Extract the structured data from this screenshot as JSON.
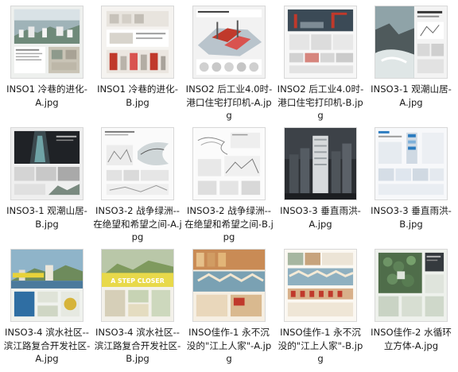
{
  "files": [
    {
      "name": "INSO1 冷巷的进化-A.jpg",
      "style": "coast"
    },
    {
      "name": "INSO1 冷巷的进化-B.jpg",
      "style": "lightboard-red"
    },
    {
      "name": "INSO2 后工业4.0时-港口住宅打印机-A.jpg",
      "style": "port-red"
    },
    {
      "name": "INSO2 后工业4.0时-港口住宅打印机-B.jpg",
      "style": "diagram-red"
    },
    {
      "name": "INSO3-1 观潮山居-A.jpg",
      "style": "cliff"
    },
    {
      "name": "INSO3-1 观潮山居-B.jpg",
      "style": "dark-canyon"
    },
    {
      "name": "INSO3-2 战争绿洲--在绝望和希望之间-A.jpg",
      "style": "sketch"
    },
    {
      "name": "INSO3-2 战争绿洲--在绝望和希望之间-B.jpg",
      "style": "sketch-light"
    },
    {
      "name": "INSO3-3 垂直雨洪-A.jpg",
      "style": "night-tower"
    },
    {
      "name": "INSO3-3 垂直雨洪-B.jpg",
      "style": "blue-diagram"
    },
    {
      "name": "INSO3-4 滨水社区--滨江路复合开发社区-A.jpg",
      "style": "riverside"
    },
    {
      "name": "INSO3-4 滨水社区--滨江路复合开发社区-B.jpg",
      "style": "step-closer"
    },
    {
      "name": "INSO佳作-1 永不沉没的\"江上人家\"-A.jpg",
      "style": "village-warm"
    },
    {
      "name": "INSO佳作-1 永不沉没的\"江上人家\"-B.jpg",
      "style": "village-board"
    },
    {
      "name": "INSO佳作-2 水循环立方体-A.jpg",
      "style": "green-plan"
    }
  ],
  "overlay_text": {
    "step_closer": "A STEP CLOSER"
  }
}
